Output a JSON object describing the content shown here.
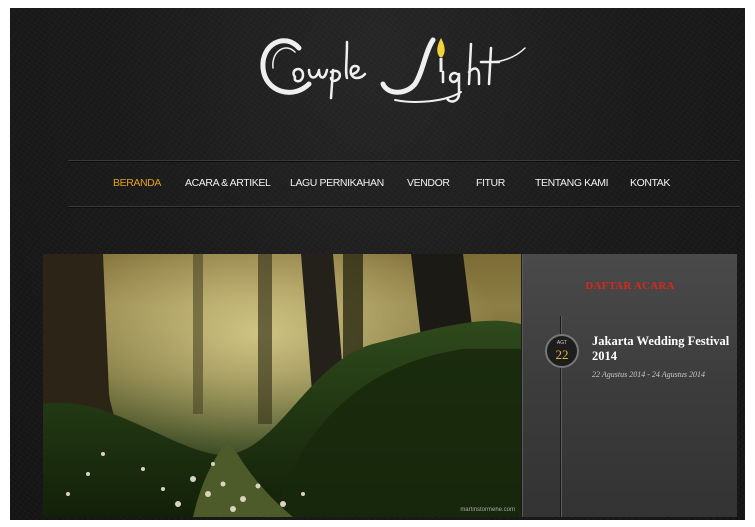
{
  "site": {
    "logo_text": "Couple Light"
  },
  "nav": {
    "items": [
      {
        "label": "BERANDA",
        "active": true
      },
      {
        "label": "ACARA & ARTIKEL",
        "active": false
      },
      {
        "label": "LAGU PERNIKAHAN",
        "active": false
      },
      {
        "label": "VENDOR",
        "active": false
      },
      {
        "label": "FITUR",
        "active": false
      },
      {
        "label": "TENTANG KAMI",
        "active": false
      },
      {
        "label": "KONTAK",
        "active": false
      }
    ]
  },
  "hero": {
    "credit": "martinstormehe.com"
  },
  "events": {
    "title": "DAFTAR ACARA",
    "items": [
      {
        "month": "AGT",
        "day": "22",
        "title": "Jakarta Wedding Festival 2014",
        "dates": "22 Agustus 2014 - 24 Agustus 2014"
      }
    ]
  },
  "colors": {
    "accent": "#e3a31a",
    "events_title": "#d8271c",
    "background": "#1b1b1b"
  }
}
